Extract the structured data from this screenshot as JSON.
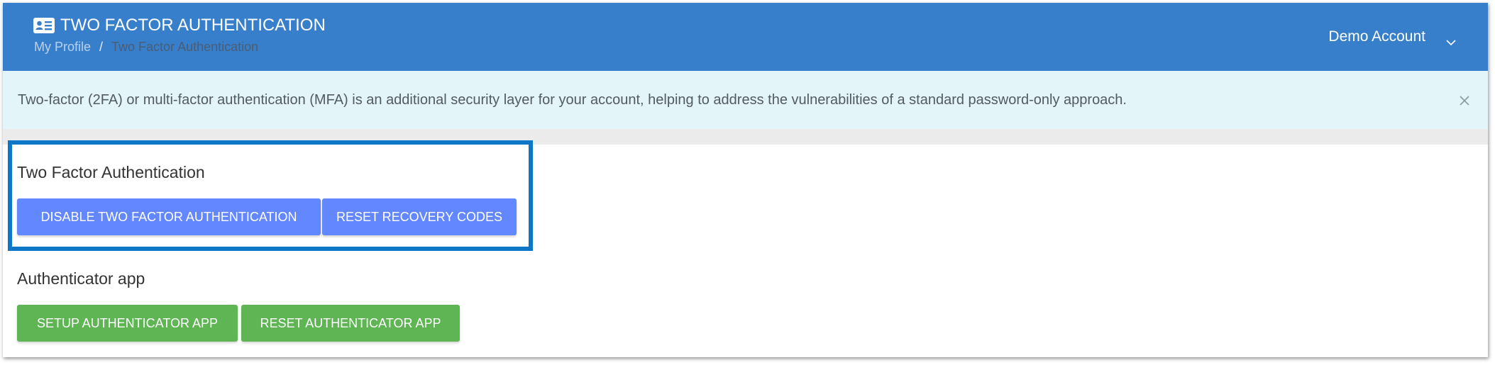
{
  "header": {
    "title": "TWO FACTOR AUTHENTICATION",
    "title_icon": "id-card-icon",
    "breadcrumb": [
      "My Profile",
      "Two Factor Authentication"
    ],
    "breadcrumb_separator": "/",
    "account": "Demo Account"
  },
  "alert": {
    "text": "Two-factor (2FA) or multi-factor authentication (MFA) is an additional security layer for your account, helping to address the vulnerabilities of a standard password-only approach."
  },
  "two_factor": {
    "title": "Two Factor Authentication",
    "disable_label": "DISABLE TWO FACTOR AUTHENTICATION",
    "reset_codes_label": "RESET RECOVERY CODES"
  },
  "authenticator": {
    "title": "Authenticator app",
    "setup_label": "SETUP AUTHENTICATOR APP",
    "reset_label": "RESET AUTHENTICATOR APP"
  },
  "colors": {
    "header": "#387fcb",
    "alert_bg": "#e3f5f9",
    "primary_button": "#6287ff",
    "success_button": "#5fb554",
    "highlight_border": "#0c77c6"
  }
}
